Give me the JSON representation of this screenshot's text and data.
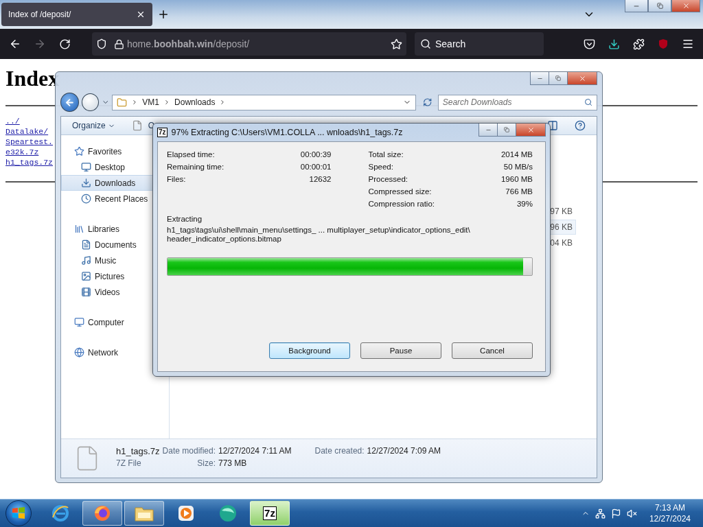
{
  "browser": {
    "tabs": [
      {
        "label": "Index of /deposit/",
        "selected": true
      }
    ],
    "url": "home.**boohbah.win**/deposit/",
    "search": {
      "placeholder": "Search"
    }
  },
  "page": {
    "heading": "Index",
    "links": [
      "../",
      "Datalake/",
      "Speartest.",
      "e32k.7z",
      "h1_tags.7z"
    ]
  },
  "explorer": {
    "breadcrumb": [
      "VM1",
      "Downloads"
    ],
    "search": {
      "placeholder": "Search Downloads"
    },
    "toolbar": [
      "Organize",
      "O"
    ],
    "nav": [
      {
        "label": "Favorites",
        "selected": false,
        "children": [
          {
            "label": "Desktop",
            "selected": false
          },
          {
            "label": "Downloads",
            "selected": true
          },
          {
            "label": "Recent Places",
            "selected": false
          }
        ]
      },
      {
        "label": "Libraries",
        "selected": false,
        "children": [
          {
            "label": "Documents",
            "selected": false
          },
          {
            "label": "Music",
            "selected": false
          },
          {
            "label": "Pictures",
            "selected": false
          },
          {
            "label": "Videos",
            "selected": false
          }
        ]
      },
      {
        "label": "Computer",
        "selected": false
      },
      {
        "label": "Network",
        "selected": false
      }
    ],
    "files": [
      {
        "size": "97 KB",
        "selected": false
      },
      {
        "size": "96 KB",
        "selected": true
      },
      {
        "size": "04 KB",
        "selected": false
      }
    ],
    "details": {
      "name": "h1_tags.7z",
      "type": "7Z File",
      "fields": [
        {
          "label": "Date modified:",
          "value": "12/27/2024 7:11 AM"
        },
        {
          "label": "Date created:",
          "value": "12/27/2024 7:09 AM"
        },
        {
          "label": "Size:",
          "value": "773 MB"
        }
      ]
    }
  },
  "dialog": {
    "logo": "7z",
    "title": "97% Extracting C:\\Users\\VM1.COLLA ... wnloads\\h1_tags.7z",
    "stats_left": [
      {
        "label": "Elapsed time:",
        "value": "00:00:39"
      },
      {
        "label": "Remaining time:",
        "value": "00:00:01"
      },
      {
        "label": "Files:",
        "value": "12632"
      }
    ],
    "stats_right": [
      {
        "label": "Total size:",
        "value": "2014 MB"
      },
      {
        "label": "Speed:",
        "value": "50 MB/s"
      },
      {
        "label": "Processed:",
        "value": "1960 MB"
      },
      {
        "label": "Compressed size:",
        "value": "766 MB"
      },
      {
        "label": "Compression ratio:",
        "value": "39%"
      }
    ],
    "status": "Extracting",
    "path_lines": [
      "h1_tags\\tags\\ui\\shell\\main_menu\\settings_ ... multiplayer_setup\\indicator_options_edit\\",
      "header_indicator_options.bitmap"
    ],
    "progress": {
      "level": 0.975
    },
    "buttons": [
      {
        "label": "Background",
        "selected": true
      },
      {
        "label": "Pause",
        "selected": false
      },
      {
        "label": "Cancel",
        "selected": false
      }
    ]
  },
  "taskbar": {
    "apps": [
      {
        "running": false,
        "selected": false
      },
      {
        "running": true,
        "selected": false
      },
      {
        "running": true,
        "selected": false
      },
      {
        "running": false,
        "selected": false
      },
      {
        "running": false,
        "selected": false
      },
      {
        "running": true,
        "selected": true
      }
    ],
    "app_logo": "7z",
    "clock": {
      "time": "7:13 AM",
      "date": "12/27/2024"
    }
  }
}
